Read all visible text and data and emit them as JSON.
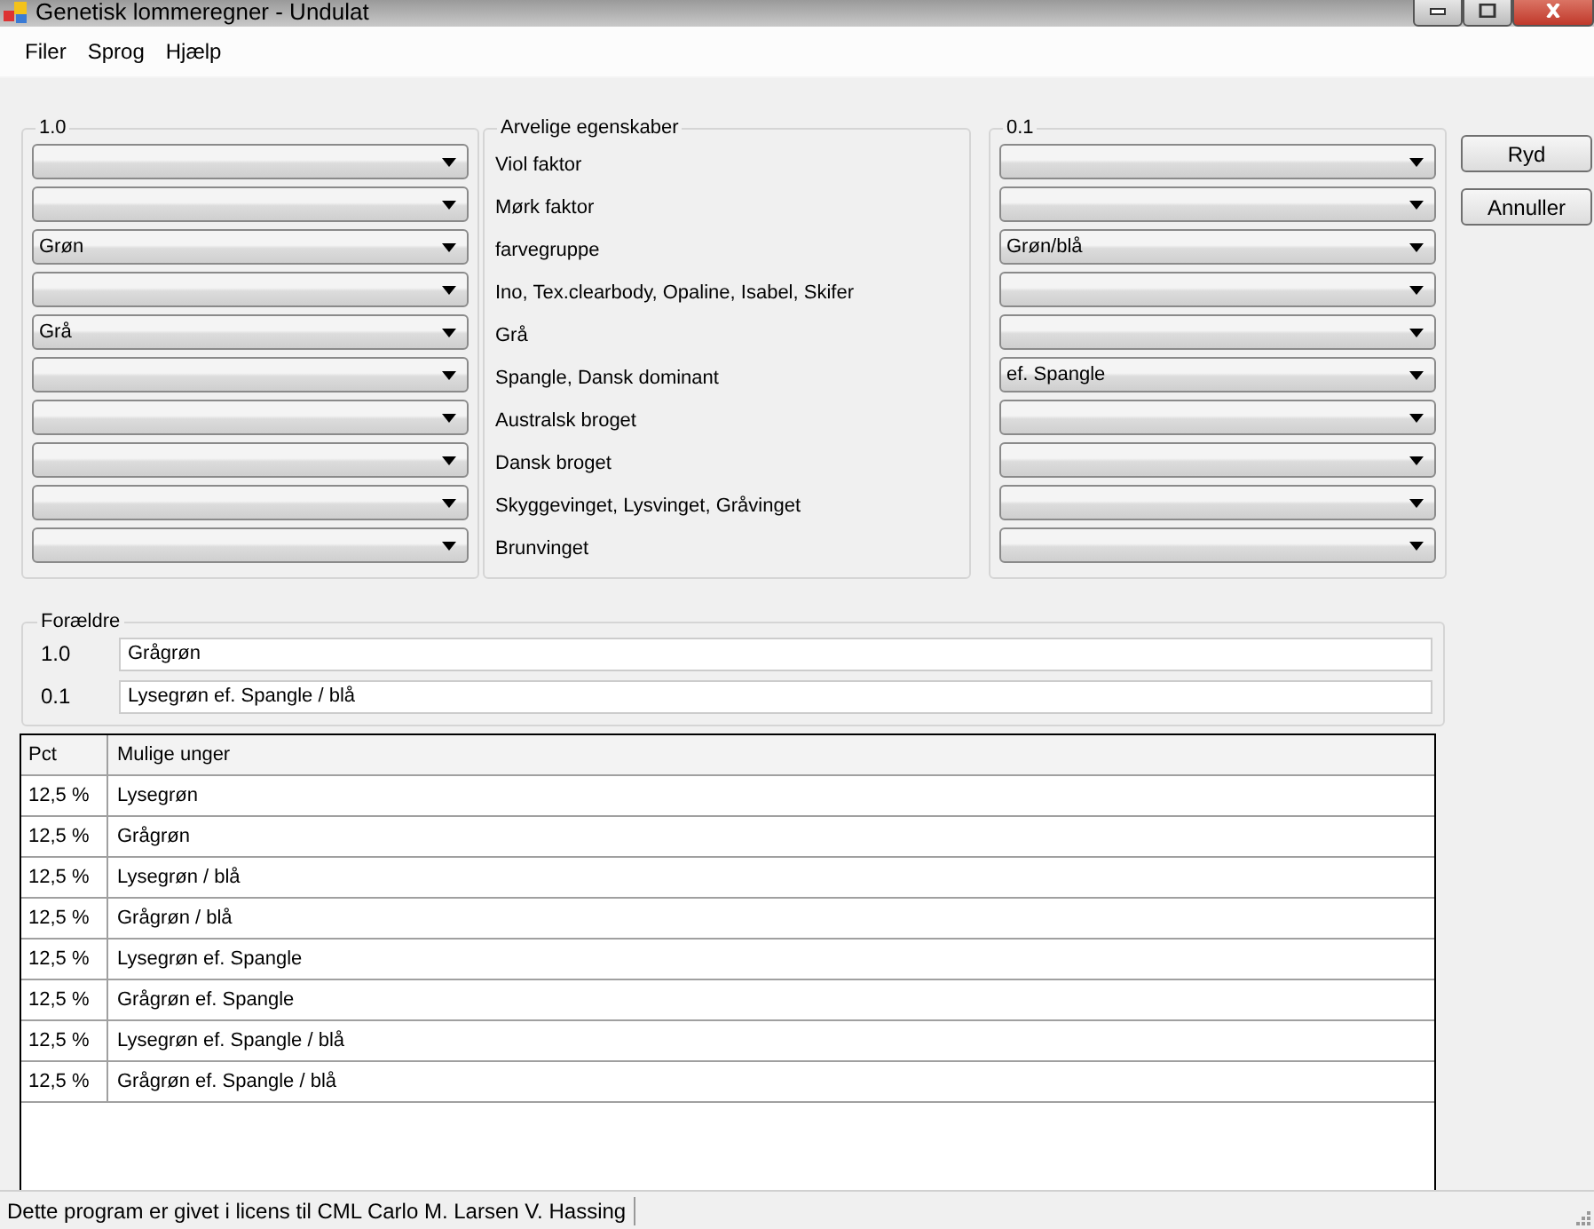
{
  "window": {
    "title": "Genetisk lommeregner - Undulat"
  },
  "menu": [
    "Filer",
    "Sprog",
    "Hjælp"
  ],
  "parent_a": {
    "title": "1.0"
  },
  "traits": {
    "title": "Arvelige egenskaber",
    "rows": [
      {
        "name": "Viol faktor"
      },
      {
        "name": "Mørk faktor"
      },
      {
        "name": "farvegruppe",
        "left": "Grøn",
        "right": "Grøn/blå"
      },
      {
        "name": "Ino, Tex.clearbody, Opaline, Isabel, Skifer"
      },
      {
        "name": "Grå",
        "left": "Grå"
      },
      {
        "name": "Spangle, Dansk dominant",
        "right": "ef. Spangle"
      },
      {
        "name": "Australsk broget"
      },
      {
        "name": "Dansk broget"
      },
      {
        "name": "Skyggevinget, Lysvinget, Gråvinget"
      },
      {
        "name": "Brunvinget"
      }
    ]
  },
  "parent_b": {
    "title": "0.1"
  },
  "buttons": [
    "Ryd",
    "Annuller"
  ],
  "parents": {
    "title": "Forældre",
    "rows": [
      {
        "label": "1.0",
        "value": "Grågrøn"
      },
      {
        "label": "0.1",
        "value": "Lysegrøn ef. Spangle / blå"
      }
    ]
  },
  "table": {
    "columns": [
      "Pct",
      "Mulige unger"
    ],
    "rows": [
      [
        "12,5 %",
        "Lysegrøn"
      ],
      [
        "12,5 %",
        "Grågrøn"
      ],
      [
        "12,5 %",
        "Lysegrøn / blå"
      ],
      [
        "12,5 %",
        "Grågrøn / blå"
      ],
      [
        "12,5 %",
        "Lysegrøn ef. Spangle"
      ],
      [
        "12,5 %",
        "Grågrøn ef. Spangle"
      ],
      [
        "12,5 %",
        "Lysegrøn ef. Spangle / blå"
      ],
      [
        "12,5 %",
        "Grågrøn ef. Spangle / blå"
      ]
    ]
  },
  "status_bar": "Dette program er givet i licens til CML Carlo M. Larsen V. Hassing"
}
